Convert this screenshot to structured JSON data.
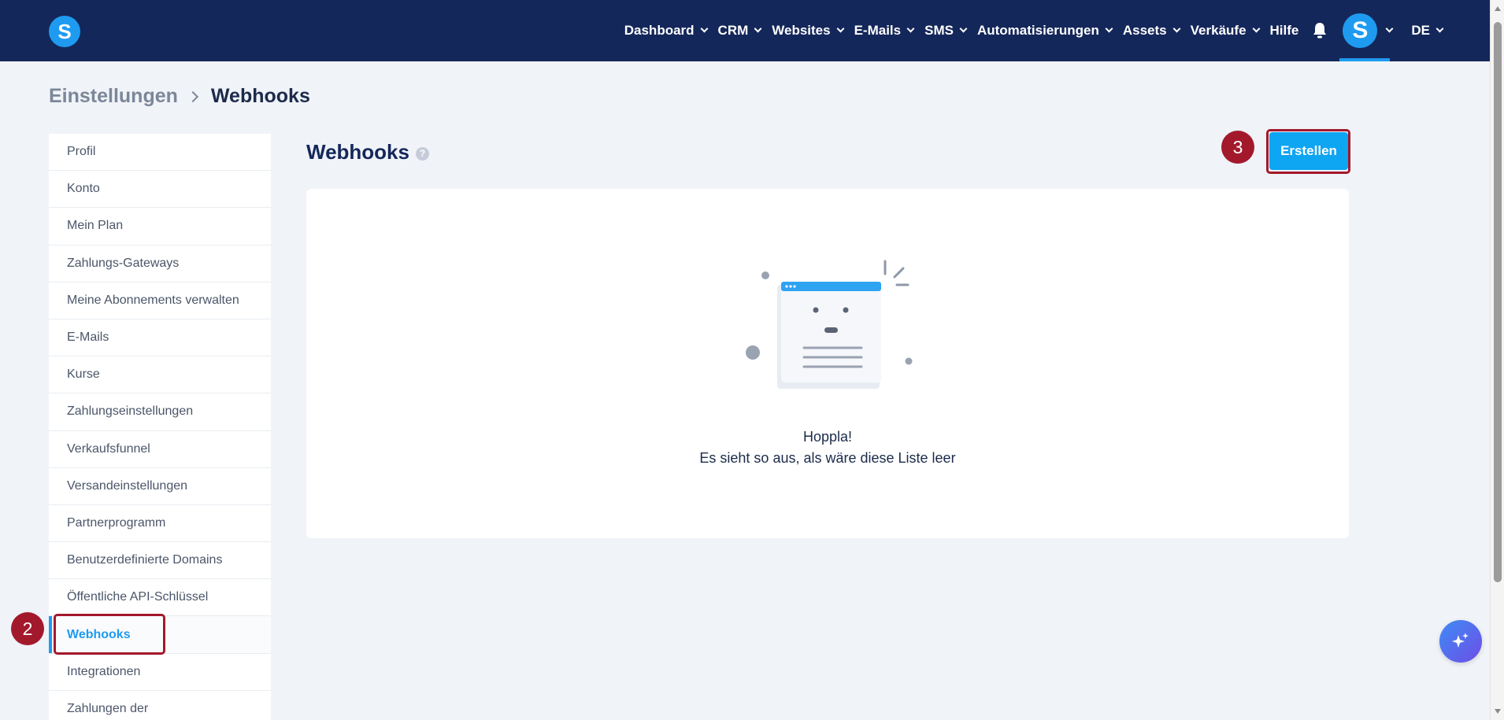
{
  "app": {
    "logo_letter": "S"
  },
  "nav": {
    "items": [
      {
        "label": "Dashboard",
        "dropdown": true
      },
      {
        "label": "CRM",
        "dropdown": true
      },
      {
        "label": "Websites",
        "dropdown": true
      },
      {
        "label": "E-Mails",
        "dropdown": true
      },
      {
        "label": "SMS",
        "dropdown": true
      },
      {
        "label": "Automatisierungen",
        "dropdown": true
      },
      {
        "label": "Assets",
        "dropdown": true
      },
      {
        "label": "Verkäufe",
        "dropdown": true
      },
      {
        "label": "Hilfe",
        "dropdown": false
      }
    ],
    "avatar_letter": "S",
    "language": "DE"
  },
  "breadcrumb": {
    "parent": "Einstellungen",
    "current": "Webhooks"
  },
  "sidebar": {
    "items": [
      {
        "label": "Profil",
        "active": false
      },
      {
        "label": "Konto",
        "active": false
      },
      {
        "label": "Mein Plan",
        "active": false
      },
      {
        "label": "Zahlungs-Gateways",
        "active": false
      },
      {
        "label": "Meine Abonnements verwalten",
        "active": false
      },
      {
        "label": "E-Mails",
        "active": false
      },
      {
        "label": "Kurse",
        "active": false
      },
      {
        "label": "Zahlungseinstellungen",
        "active": false
      },
      {
        "label": "Verkaufsfunnel",
        "active": false
      },
      {
        "label": "Versandeinstellungen",
        "active": false
      },
      {
        "label": "Partnerprogramm",
        "active": false
      },
      {
        "label": "Benutzerdefinierte Domains",
        "active": false
      },
      {
        "label": "Öffentliche API-Schlüssel",
        "active": false
      },
      {
        "label": "Webhooks",
        "active": true
      },
      {
        "label": "Integrationen",
        "active": false
      },
      {
        "label": "Zahlungen der",
        "active": false
      }
    ]
  },
  "main": {
    "title": "Webhooks",
    "help_symbol": "?",
    "create_label": "Erstellen",
    "empty_title": "Hoppla!",
    "empty_subtitle": "Es sieht so aus, als wäre diese Liste leer"
  },
  "annotations": {
    "step_sidebar": "2",
    "step_create": "3"
  },
  "colors": {
    "topbar": "#14275a",
    "accent": "#1e9bf0",
    "button": "#0ea5f2",
    "annotation": "#a3192c"
  }
}
